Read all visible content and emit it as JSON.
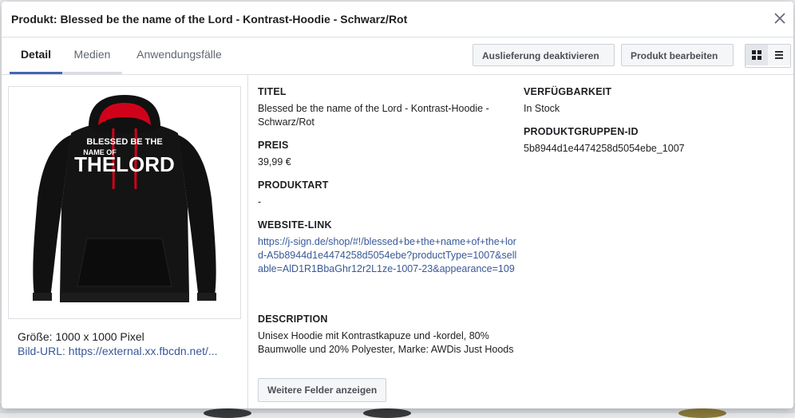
{
  "modal": {
    "title": "Produkt: Blessed be the name of the Lord - Kontrast-Hoodie - Schwarz/Rot"
  },
  "tabs": [
    {
      "label": "Detail"
    },
    {
      "label": "Medien"
    },
    {
      "label": "Anwendungsfälle"
    }
  ],
  "actions": {
    "deactivate": "Auslieferung deaktivieren",
    "edit": "Produkt bearbeiten"
  },
  "view_toggle": {
    "grid_icon": "grid-icon",
    "list_icon": "list-icon"
  },
  "image": {
    "print_line1": "BLESSED BE THE",
    "print_line2": "NAME OF",
    "print_line3": "THELORD",
    "size": "Größe: 1000 x 1000 Pixel",
    "url": "Bild-URL: https://external.xx.fbcdn.net/..."
  },
  "fields": {
    "title_label": "TITEL",
    "title_value": "Blessed be the name of the Lord - Kontrast-Hoodie - Schwarz/Rot",
    "price_label": "PREIS",
    "price_value": "39,99 €",
    "type_label": "PRODUKTART",
    "type_value": "-",
    "link_label": "WEBSITE-LINK",
    "link_value": "https://j-sign.de/shop/#!/blessed+be+the+name+of+the+lord-A5b8944d1e4474258d5054ebe?productType=1007&sellable=AlD1R1BbaGhr12r2L1ze-1007-23&appearance=109",
    "desc_label": "DESCRIPTION",
    "desc_value": "Unisex Hoodie mit Kontrastkapuze und -kordel, 80% Baumwolle und 20% Polyester, Marke: AWDis Just Hoods",
    "availability_label": "VERFÜGBARKEIT",
    "availability_value": "In Stock",
    "group_label": "PRODUKTGRUPPEN-ID",
    "group_value": "5b8944d1e4474258d5054ebe_1007",
    "more_button": "Weitere Felder anzeigen"
  },
  "colors": {
    "accent": "#4267b2",
    "link": "#385898",
    "hoodie": "#111111",
    "hood_lining": "#d0021b"
  }
}
